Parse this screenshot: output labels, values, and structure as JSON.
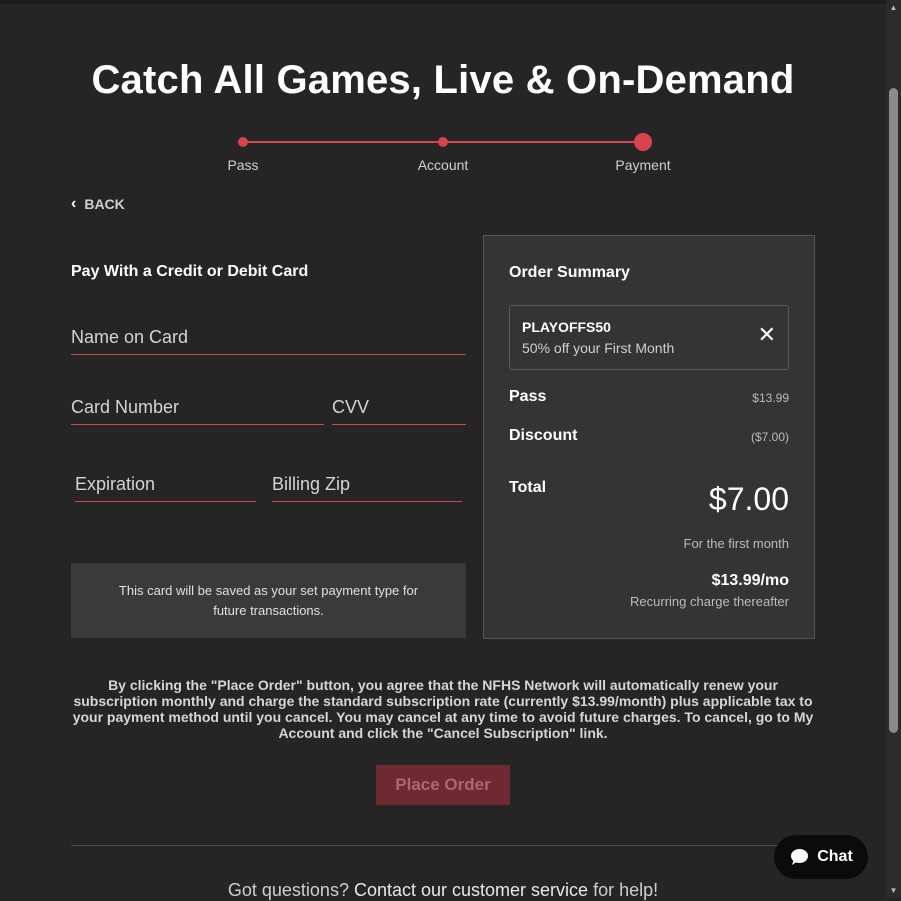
{
  "hero": {
    "title": "Catch All Games, Live & On-Demand"
  },
  "steps": [
    "Pass",
    "Account",
    "Payment"
  ],
  "back_label": "BACK",
  "payment_form": {
    "title": "Pay With a Credit or Debit Card",
    "name_on_card": "Name on Card",
    "card_number": "Card Number",
    "cvv": "CVV",
    "expiration": "Expiration",
    "billing_zip": "Billing Zip",
    "saved_note": "This card will be saved as your set payment type for future transactions."
  },
  "order_summary": {
    "title": "Order Summary",
    "promo_code": "PLAYOFFS50",
    "promo_desc": "50% off your First Month",
    "pass_label": "Pass",
    "pass_value": "$13.99",
    "discount_label": "Discount",
    "discount_value": "($7.00)",
    "total_label": "Total",
    "total_value": "$7.00",
    "first_month": "For the first month",
    "recurring_price": "$13.99/mo",
    "recurring_text": "Recurring charge thereafter"
  },
  "terms": "By clicking the \"Place Order\" button, you agree that the NFHS Network will automatically renew your subscription monthly and charge the standard subscription rate (currently $13.99/month) plus applicable tax to your payment method until you cancel. You may cancel at any time to avoid future charges. To cancel, go to My Account and click the \"Cancel Subscription\" link.",
  "place_order": "Place Order",
  "footer": {
    "prefix": "Got questions? ",
    "link": "Contact our customer service",
    "suffix": " for help!"
  },
  "chat_label": "Chat",
  "colors": {
    "accent": "#d9434d",
    "button_disabled": "#6e2a31",
    "background": "#252525",
    "panel": "#343434"
  }
}
